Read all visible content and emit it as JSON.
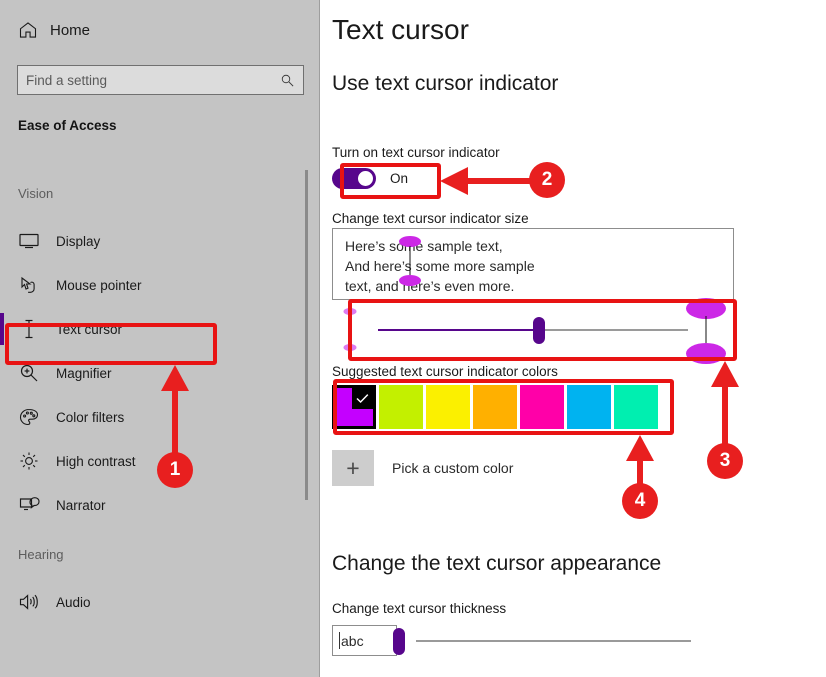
{
  "sidebar": {
    "home_label": "Home",
    "home_icon": "home-icon",
    "search": {
      "placeholder": "Find a setting",
      "value": "",
      "icon": "search-icon"
    },
    "app_title": "Ease of Access",
    "groups": [
      {
        "label": "Vision",
        "items": [
          {
            "label": "Display",
            "icon": "monitor-icon",
            "selected": false
          },
          {
            "label": "Mouse pointer",
            "icon": "pointer-hand-icon",
            "selected": false
          },
          {
            "label": "Text cursor",
            "icon": "text-cursor-icon",
            "selected": true
          },
          {
            "label": "Magnifier",
            "icon": "magnifier-icon",
            "selected": false
          },
          {
            "label": "Color filters",
            "icon": "palette-icon",
            "selected": false
          },
          {
            "label": "High contrast",
            "icon": "sun-icon",
            "selected": false
          },
          {
            "label": "Narrator",
            "icon": "narrator-icon",
            "selected": false
          }
        ]
      },
      {
        "label": "Hearing",
        "items": [
          {
            "label": "Audio",
            "icon": "speaker-icon",
            "selected": false
          }
        ]
      }
    ]
  },
  "main": {
    "page_title": "Text cursor",
    "sections": [
      {
        "heading": "Use text cursor indicator",
        "toggle_label": "Turn on text cursor indicator",
        "toggle_state": "On",
        "toggle_on": true,
        "size_label": "Change text cursor indicator size",
        "preview_lines": [
          "Here’s some sample text,",
          "And here’s some more sample",
          "text, and here’s even more."
        ],
        "size_slider": {
          "value": 52,
          "min": 0,
          "max": 100
        },
        "colors_label": "Suggested text cursor indicator colors",
        "swatches": [
          {
            "name": "magenta",
            "hex": "#c400ff",
            "selected": true
          },
          {
            "name": "yellow-green",
            "hex": "#c3f000",
            "selected": false
          },
          {
            "name": "yellow",
            "hex": "#fbf000",
            "selected": false
          },
          {
            "name": "orange",
            "hex": "#ffb000",
            "selected": false
          },
          {
            "name": "pink",
            "hex": "#ff00a8",
            "selected": false
          },
          {
            "name": "sky-blue",
            "hex": "#00b3f0",
            "selected": false
          },
          {
            "name": "spring-green",
            "hex": "#00efb0",
            "selected": false
          }
        ],
        "custom_color_label": "Pick a custom color",
        "custom_color_icon": "plus-icon"
      },
      {
        "heading": "Change the text cursor appearance",
        "thickness_label": "Change text cursor thickness",
        "thickness_preview_text": "abc",
        "thickness_slider": {
          "value": 0,
          "min": 0,
          "max": 100
        }
      }
    ],
    "accent_color": "#57068c",
    "indicator_color": "#cc28e6"
  },
  "annotations": {
    "marker_color": "#e81f1f",
    "markers": [
      {
        "number": "1",
        "target": "sidebar-item-text-cursor"
      },
      {
        "number": "2",
        "target": "text-cursor-indicator-toggle"
      },
      {
        "number": "3",
        "target": "text-cursor-indicator-size-slider"
      },
      {
        "number": "4",
        "target": "suggested-colors-swatches"
      }
    ]
  }
}
